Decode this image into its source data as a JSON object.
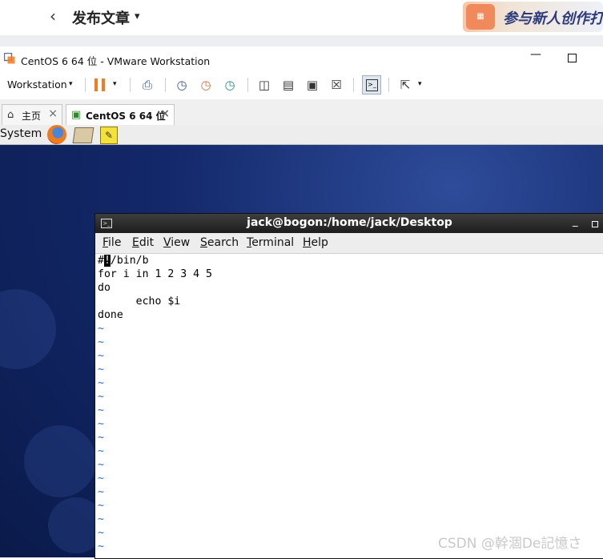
{
  "csdn": {
    "back_glyph": "‹",
    "title": "发布文章",
    "caret": "▾",
    "banner_text": "参与新人创作打",
    "banner_icon": "calendar-icon"
  },
  "vmware": {
    "window_title": "CentOS 6 64 位 - VMware Workstation",
    "min_glyph": "—",
    "toolbar": {
      "workstation_label": "Workstation",
      "caret": "▾"
    },
    "tabs": [
      {
        "label": "主页",
        "icon": "home-icon",
        "glyph": "⌂",
        "close": "×"
      },
      {
        "label": "CentOS 6 64 位",
        "icon": "vm-icon",
        "glyph": "▣",
        "close": "×"
      }
    ]
  },
  "guest": {
    "panel_system": "System",
    "notes_glyph": "✎",
    "terminal": {
      "title": "jack@bogon:/home/jack/Desktop",
      "min_glyph": "_",
      "menus": [
        {
          "u": "F",
          "rest": "ile"
        },
        {
          "u": "E",
          "rest": "dit"
        },
        {
          "u": "V",
          "rest": "iew"
        },
        {
          "u": "S",
          "rest": "earch"
        },
        {
          "u": "T",
          "rest": "erminal"
        },
        {
          "u": "H",
          "rest": "elp"
        }
      ],
      "lines": {
        "l1_pre": "#",
        "l1_cursor": "!",
        "l1_post": "/bin/b",
        "l2": "for i in 1 2 3 4 5",
        "l3": "do",
        "l4": "      echo $i",
        "l5": "done"
      },
      "tilde": "~",
      "tilde_count": 17
    }
  },
  "watermark": "CSDN @幹涸De記憶さ",
  "colors": {
    "accent_orange": "#f47c20",
    "terminal_tilde": "#2a6ad0",
    "desktop_blue": "#13286a"
  }
}
